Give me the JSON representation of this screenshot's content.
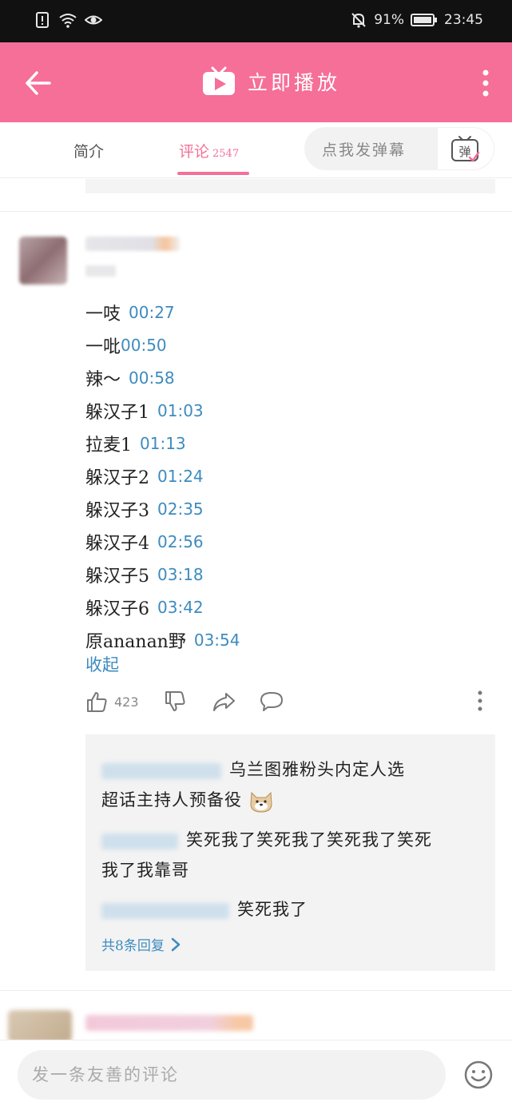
{
  "status_bar": {
    "battery": "91%",
    "time": "23:45"
  },
  "app_bar": {
    "title": "立即播放"
  },
  "tabs": {
    "intro_label": "简介",
    "comments_label": "评论",
    "comments_count": "2547",
    "danmaku_placeholder": "点我发弹幕",
    "danmaku_button_label": "弹"
  },
  "comment": {
    "lines": [
      {
        "text": "一吱",
        "time": "00:27"
      },
      {
        "text": "一吡",
        "time": "00:50"
      },
      {
        "text": "辣～",
        "time": "00:58"
      },
      {
        "text": "躲汉子1",
        "time": "01:03"
      },
      {
        "text": "拉麦1",
        "time": "01:13"
      },
      {
        "text": "躲汉子2",
        "time": "01:24"
      },
      {
        "text": "躲汉子3",
        "time": "02:35"
      },
      {
        "text": "躲汉子4",
        "time": "02:56"
      },
      {
        "text": "躲汉子5",
        "time": "03:18"
      },
      {
        "text": "躲汉子6",
        "time": "03:42"
      },
      {
        "text": "原ananan野",
        "time": "03:54"
      }
    ],
    "collapse_label": "收起",
    "like_count": "423"
  },
  "replies": {
    "items": [
      {
        "line1": "乌兰图雅粉头内定人选",
        "line2": "超话主持人预备役"
      },
      {
        "line1": "笑死我了笑死我了笑死我了笑死",
        "line2": "我了我靠哥"
      },
      {
        "line1": "笑死我了"
      }
    ],
    "more_label": "共8条回复"
  },
  "input": {
    "placeholder": "发一条友善的评论"
  }
}
